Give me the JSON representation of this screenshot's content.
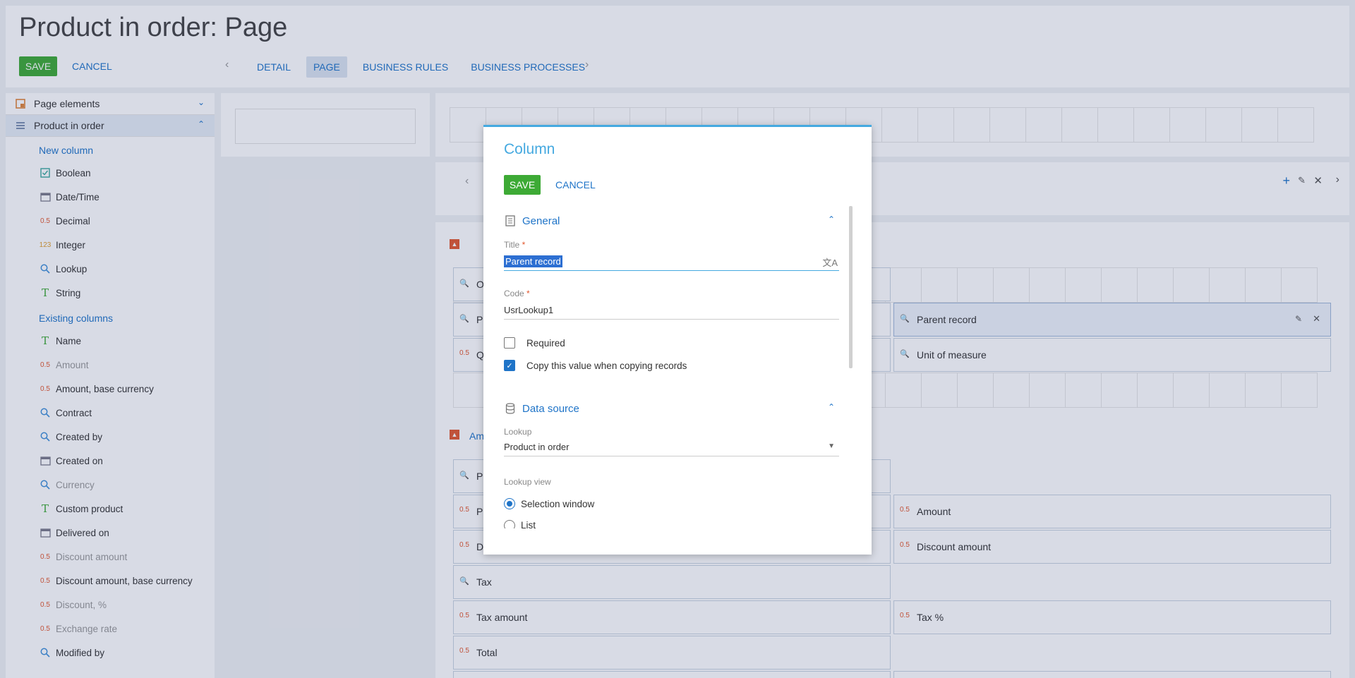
{
  "header": {
    "title": "Product in order: Page",
    "save_label": "SAVE",
    "cancel_label": "CANCEL",
    "tabs": [
      {
        "label": "DETAIL",
        "active": false
      },
      {
        "label": "PAGE",
        "active": true
      },
      {
        "label": "BUSINESS RULES",
        "active": false
      },
      {
        "label": "BUSINESS PROCESSES",
        "active": false
      }
    ],
    "prev_arrow": "‹",
    "next_arrow": "›"
  },
  "sidebar": {
    "sections": [
      {
        "label": "Page elements",
        "icon": "page-elements-icon",
        "expanded": false
      },
      {
        "label": "Product in order",
        "icon": "list-icon",
        "expanded": true
      }
    ],
    "new_column_label": "New column",
    "new_columns": [
      {
        "label": "Boolean",
        "icon": "checkbox-icon"
      },
      {
        "label": "Date/Time",
        "icon": "calendar-icon"
      },
      {
        "label": "Decimal",
        "icon": "decimal-icon"
      },
      {
        "label": "Integer",
        "icon": "integer-icon"
      },
      {
        "label": "Lookup",
        "icon": "search-icon"
      },
      {
        "label": "String",
        "icon": "string-icon"
      }
    ],
    "existing_columns_label": "Existing columns",
    "existing_columns": [
      {
        "label": "Name",
        "icon": "string-icon",
        "dim": false
      },
      {
        "label": "Amount",
        "icon": "decimal-icon",
        "dim": true
      },
      {
        "label": "Amount, base currency",
        "icon": "decimal-icon",
        "dim": false
      },
      {
        "label": "Contract",
        "icon": "search-icon",
        "dim": false
      },
      {
        "label": "Created by",
        "icon": "search-icon",
        "dim": false
      },
      {
        "label": "Created on",
        "icon": "calendar-icon",
        "dim": false
      },
      {
        "label": "Currency",
        "icon": "search-icon",
        "dim": true
      },
      {
        "label": "Custom product",
        "icon": "string-icon",
        "dim": false
      },
      {
        "label": "Delivered on",
        "icon": "calendar-icon",
        "dim": false
      },
      {
        "label": "Discount amount",
        "icon": "decimal-icon",
        "dim": true
      },
      {
        "label": "Discount amount, base currency",
        "icon": "decimal-icon",
        "dim": false
      },
      {
        "label": "Discount, %",
        "icon": "decimal-icon",
        "dim": true
      },
      {
        "label": "Exchange rate",
        "icon": "decimal-icon",
        "dim": true
      },
      {
        "label": "Modified by",
        "icon": "search-icon",
        "dim": false
      }
    ],
    "decimal_glyph": "0.5",
    "integer_glyph": "123",
    "string_glyph": "T"
  },
  "canvas": {
    "fields": {
      "o_field": "O",
      "p_field": "P",
      "q_field": "Q",
      "parent_record": "Parent record",
      "unit_of_measure": "Unit of measure",
      "am_group": "Am",
      "p2_field": "P",
      "p3_field": "P",
      "d_field": "D",
      "amount": "Amount",
      "discount_amount": "Discount amount",
      "tax": "Tax",
      "tax_amount": "Tax amount",
      "tax_percent": "Tax %",
      "total": "Total"
    }
  },
  "modal": {
    "title": "Column",
    "save_label": "SAVE",
    "cancel_label": "CANCEL",
    "general_section": "General",
    "title_label": "Title",
    "title_value": "Parent record",
    "code_label": "Code",
    "code_value": "UsrLookup1",
    "required_label": "Required",
    "required_checked": false,
    "copy_label": "Copy this value when copying records",
    "copy_checked": true,
    "data_source_section": "Data source",
    "lookup_label": "Lookup",
    "lookup_value": "Product in order",
    "lookup_view_label": "Lookup view",
    "view_options": [
      {
        "label": "Selection window",
        "selected": true
      },
      {
        "label": "List",
        "selected": false
      }
    ],
    "required_mark": "*"
  },
  "colors": {
    "accent": "#45a9e0",
    "save_green": "#3daa35",
    "link_blue": "#1f74c8",
    "decimal_orange": "#e2582f"
  }
}
